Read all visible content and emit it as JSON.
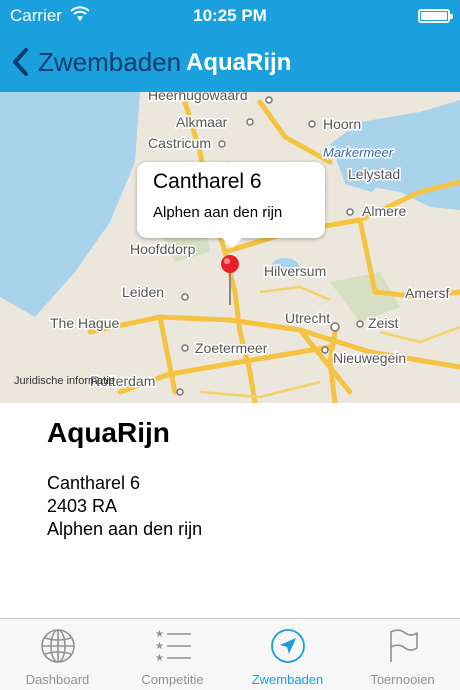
{
  "status_bar": {
    "carrier": "Carrier",
    "time": "10:25 PM"
  },
  "nav": {
    "back_label": "Zwembaden",
    "title": "AquaRijn"
  },
  "map": {
    "labels": [
      "Heerhugowaard",
      "Alkmaar",
      "Hoorn",
      "Castricum",
      "Markermeer",
      "Lelystad",
      "Almere",
      "Hoofddorp",
      "Hilversum",
      "Amersf",
      "Leiden",
      "The Hague",
      "Utrecht",
      "Zeist",
      "Zoetermeer",
      "Nieuwegein",
      "Rotterdam"
    ],
    "legal": "Juridische informatie",
    "callout": {
      "title": "Cantharel 6",
      "subtitle": "Alphen aan den rijn"
    }
  },
  "details": {
    "name": "AquaRijn",
    "street": "Cantharel 6",
    "postcode": "2403 RA",
    "city": "Alphen aan den rijn"
  },
  "tabs": [
    {
      "label": "Dashboard",
      "icon": "globe-icon"
    },
    {
      "label": "Competitie",
      "icon": "ranked-list-icon"
    },
    {
      "label": "Zwembaden",
      "icon": "location-arrow-icon",
      "active": true
    },
    {
      "label": "Toernooien",
      "icon": "flag-icon"
    }
  ],
  "colors": {
    "accent": "#1aa0dc",
    "back_text": "#0a3c6e",
    "road": "#f5c342",
    "land": "#ece7dc",
    "water": "#a9d3ea"
  }
}
